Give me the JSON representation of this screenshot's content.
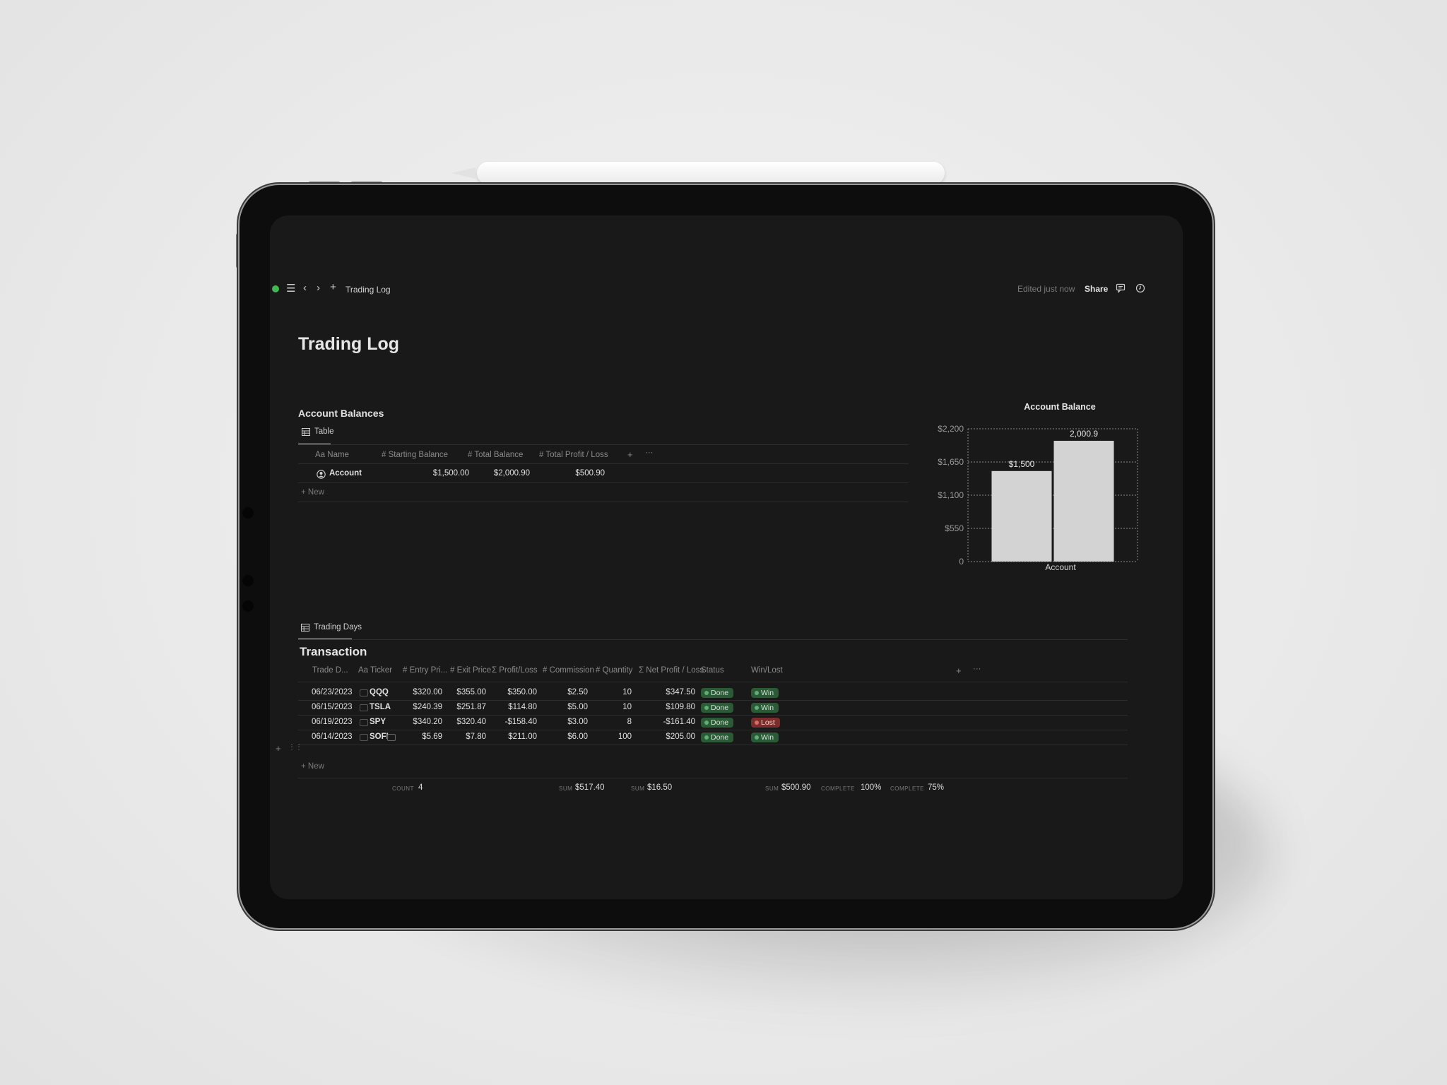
{
  "topbar": {
    "breadcrumb": "Trading Log",
    "edited": "Edited just now",
    "share": "Share"
  },
  "page": {
    "title": "Trading Log"
  },
  "balances": {
    "heading": "Account Balances",
    "view_tab": "Table",
    "columns": [
      "Aa Name",
      "# Starting Balance",
      "# Total Balance",
      "# Total Profit / Loss"
    ],
    "row": {
      "name": "Account",
      "starting": "$1,500.00",
      "total": "$2,000.90",
      "pl": "$500.90"
    },
    "new_label": "+ New"
  },
  "chart_data": {
    "type": "bar",
    "title": "Account Balance",
    "categories": [
      "Account"
    ],
    "series": [
      {
        "name": "",
        "values": [
          1500
        ]
      },
      {
        "name": "",
        "values": [
          2000.9
        ]
      }
    ],
    "data_labels": [
      "$1,500",
      "2,000.9"
    ],
    "ylim": [
      0,
      2200
    ],
    "yticks": [
      "$2,200",
      "$1,650",
      "$1,100",
      "$550",
      "0"
    ],
    "xlabel": "Account",
    "grid": true,
    "bar_color": "#d3d3d3"
  },
  "trading": {
    "tab": "Trading Days",
    "heading": "Transaction",
    "columns": [
      "Trade D...",
      "Aa Ticker",
      "# Entry Pri...",
      "# Exit Price",
      "Σ Profit/Loss",
      "# Commission",
      "# Quantity",
      "Σ Net Profit / Loss",
      "Status",
      "Win/Lost"
    ],
    "rows": [
      {
        "date": "06/23/2023",
        "ticker": "QQQ",
        "entry": "$320.00",
        "exit": "$355.00",
        "pl": "$350.00",
        "comm": "$2.50",
        "qty": "10",
        "net": "$347.50",
        "status": "Done",
        "result": "Win"
      },
      {
        "date": "06/15/2023",
        "ticker": "TSLA",
        "entry": "$240.39",
        "exit": "$251.87",
        "pl": "$114.80",
        "comm": "$5.00",
        "qty": "10",
        "net": "$109.80",
        "status": "Done",
        "result": "Win"
      },
      {
        "date": "06/19/2023",
        "ticker": "SPY",
        "entry": "$340.20",
        "exit": "$320.40",
        "pl": "-$158.40",
        "comm": "$3.00",
        "qty": "8",
        "net": "-$161.40",
        "status": "Done",
        "result": "Lost"
      },
      {
        "date": "06/14/2023",
        "ticker": "SOFI",
        "entry": "$5.69",
        "exit": "$7.80",
        "pl": "$211.00",
        "comm": "$6.00",
        "qty": "100",
        "net": "$205.00",
        "status": "Done",
        "result": "Win"
      }
    ],
    "new_label": "+ New",
    "footer": {
      "count_label": "COUNT",
      "count": "4",
      "sum_pl_label": "SUM",
      "sum_pl": "$517.40",
      "sum_comm_label": "SUM",
      "sum_comm": "$16.50",
      "sum_net_label": "SUM",
      "sum_net": "$500.90",
      "status_label": "COMPLETE",
      "status_pct": "100%",
      "win_label": "COMPLETE",
      "win_pct": "75%"
    }
  }
}
